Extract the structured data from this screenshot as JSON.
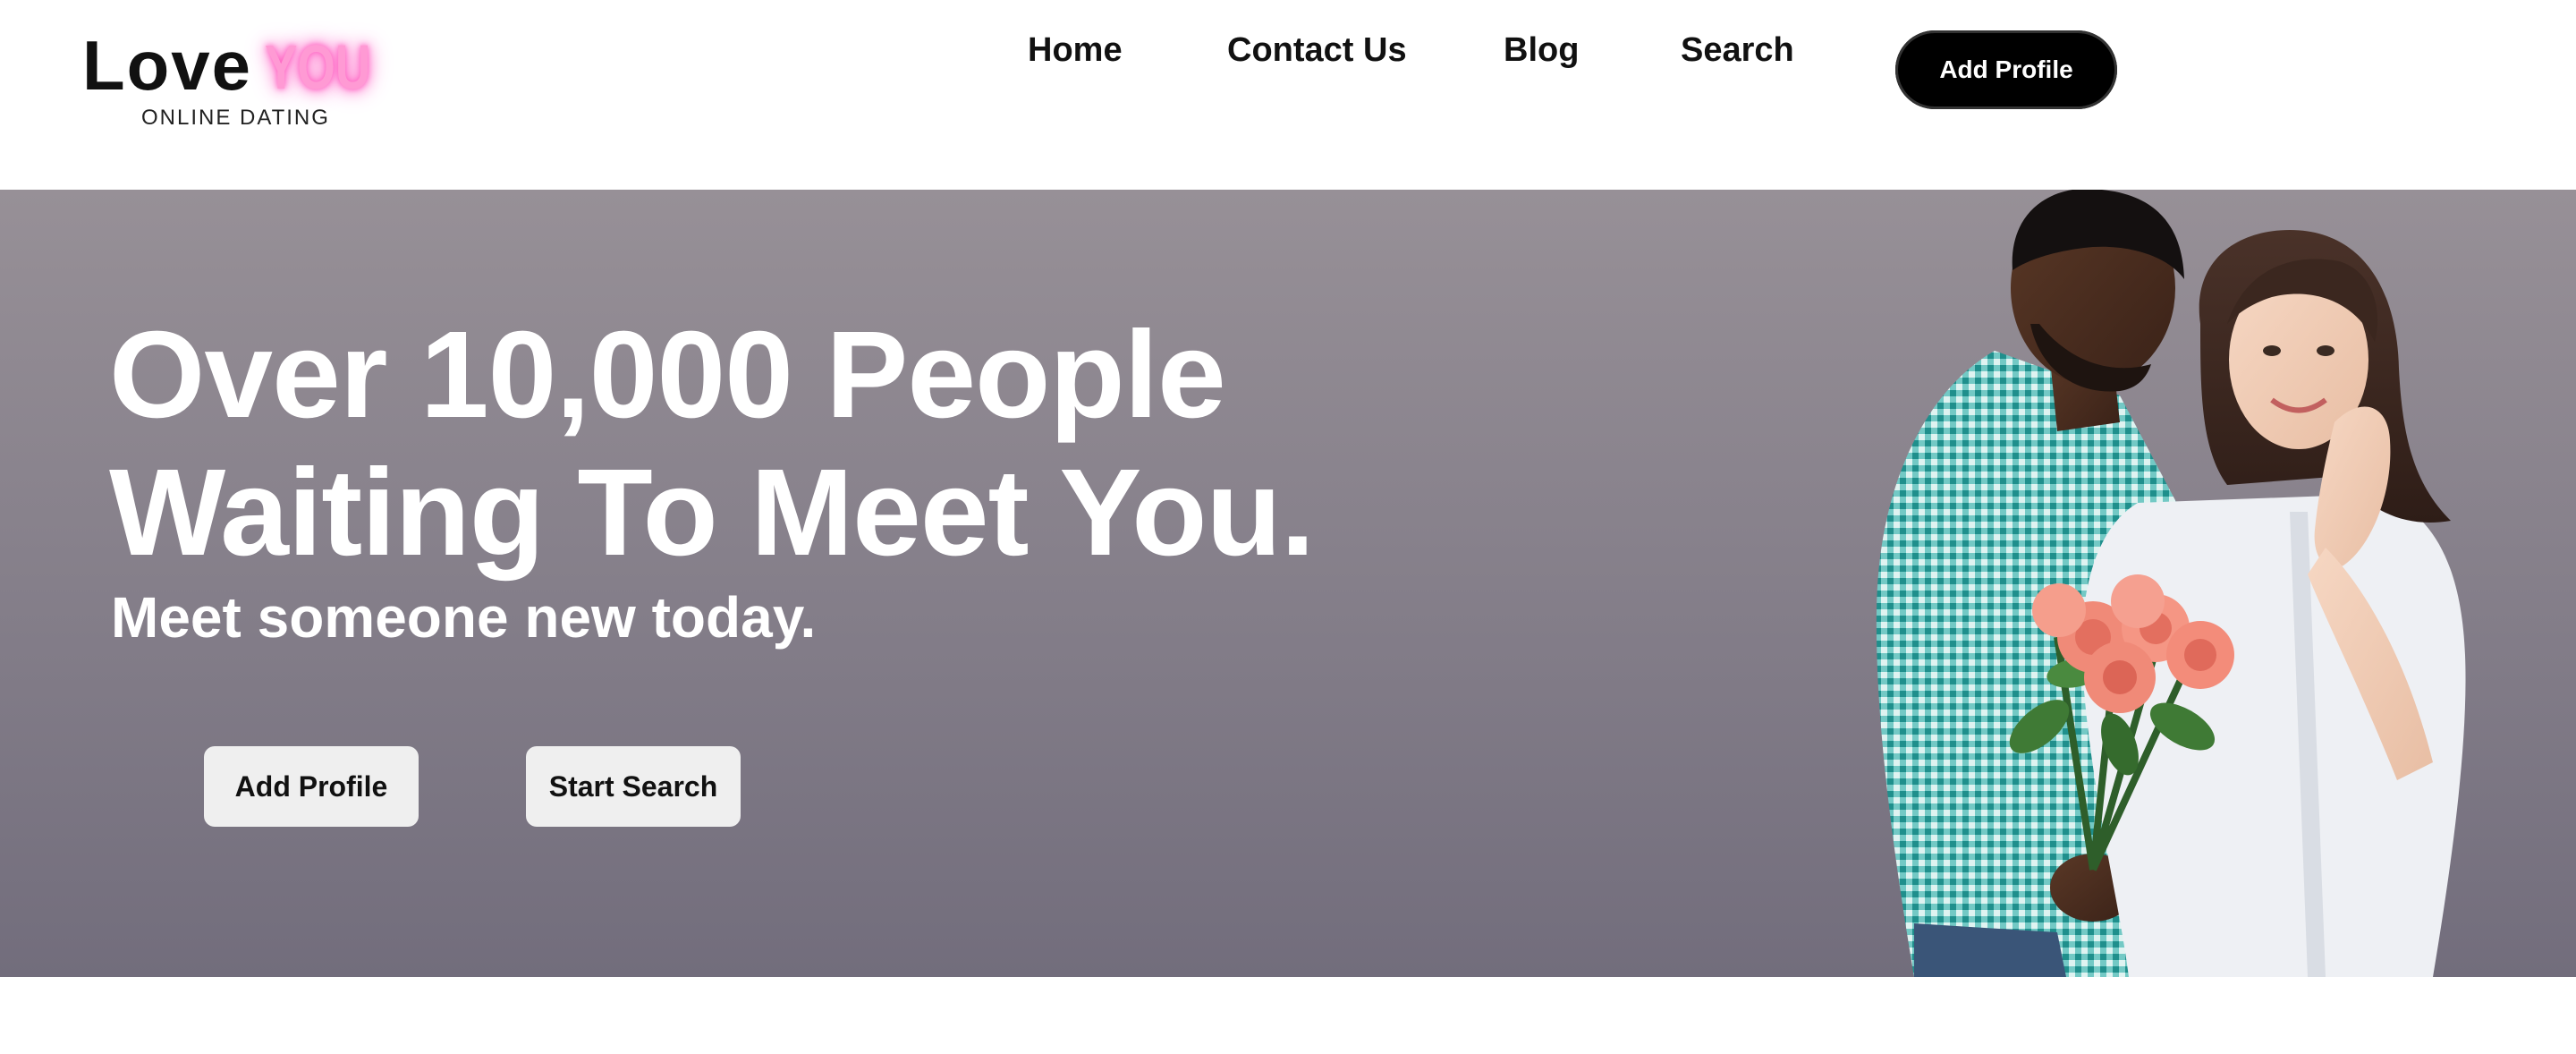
{
  "logo": {
    "love": "Love",
    "you": "YOU",
    "tagline": "ONLINE DATING"
  },
  "nav": {
    "items": [
      {
        "label": "Home"
      },
      {
        "label": "Contact Us"
      },
      {
        "label": "Blog"
      },
      {
        "label": "Search"
      }
    ],
    "cta_label": "Add Profile"
  },
  "hero": {
    "title_line1": "Over 10,000 People",
    "title_line2": "Waiting To Meet You.",
    "subtitle": "Meet someone new today.",
    "buttons": {
      "add_profile": "Add Profile",
      "start_search": "Start Search"
    }
  },
  "colors": {
    "accent_pink": "#ff5cc0",
    "button_black": "#000000",
    "hero_bg_top": "#979097",
    "hero_bg_bottom": "#726d7c",
    "shirt_teal": "#3fb3b0",
    "roses": "#f07e6e"
  }
}
